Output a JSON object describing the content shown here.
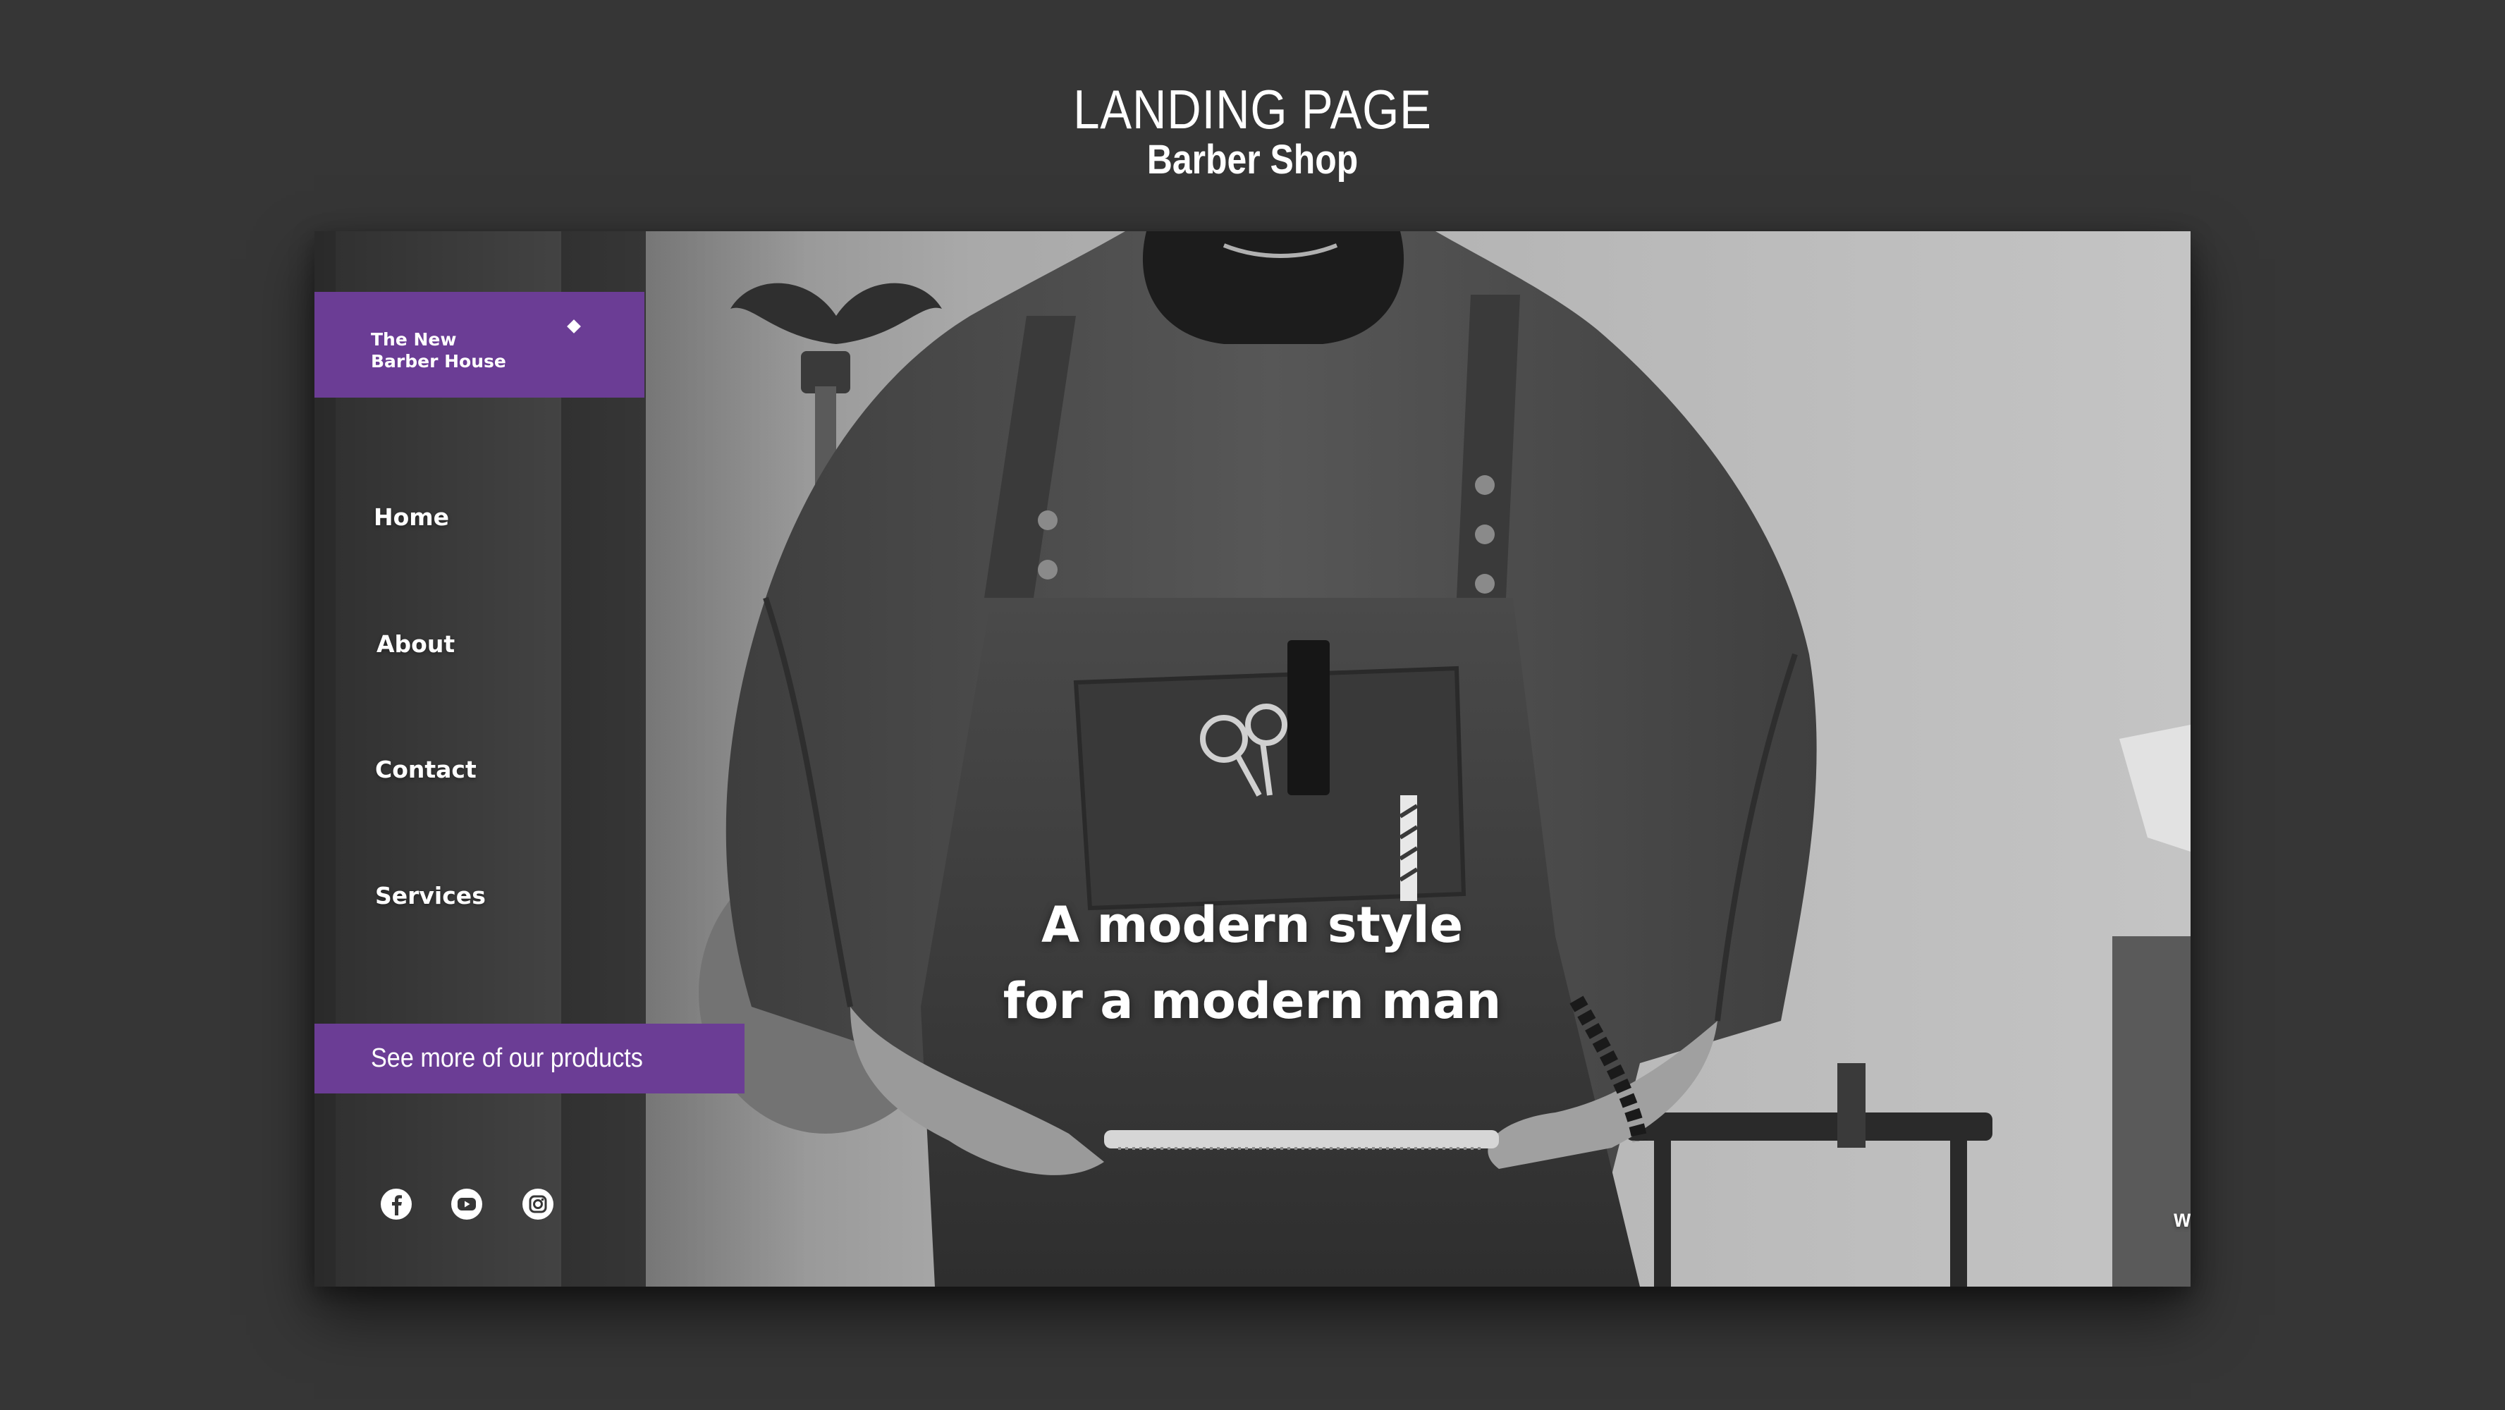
{
  "presentation": {
    "title": "LANDING PAGE",
    "subtitle": "Barber Shop"
  },
  "brand": {
    "name": "The New\nBarber House"
  },
  "nav": {
    "items": [
      {
        "label": "Home"
      },
      {
        "label": "About"
      },
      {
        "label": "Contact"
      },
      {
        "label": "Services"
      }
    ]
  },
  "cta": {
    "label": "See more of our products"
  },
  "hero": {
    "headline_line1": "A modern style",
    "headline_line2": "for a modern man",
    "image_description": "black-and-white photo of a bearded barber in a leather apron holding a comb"
  },
  "social": {
    "icons": [
      "facebook-icon",
      "youtube-icon",
      "instagram-icon"
    ]
  },
  "footer": {
    "url": "www.newbarberhouse.com"
  },
  "colors": {
    "background": "#363636",
    "accent": "#6b3d95",
    "text": "#ffffff"
  }
}
